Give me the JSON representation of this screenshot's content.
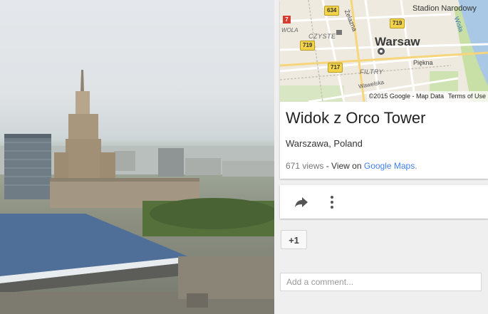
{
  "photo": {
    "alt_subject": "Warsaw skyline viewed from Orco Tower"
  },
  "map": {
    "city": "Warsaw",
    "stadium": "Stadion Narodowy",
    "street_piekna": "Piękna",
    "district_filtry": "FILTRY",
    "district_czyste": "CZYSTE",
    "district_wola": "WOLA",
    "street_wawelska": "Wawelska",
    "street_zelazna": "Żelazna",
    "river": "Wisła",
    "route_634": "634",
    "route_719_a": "719",
    "route_719_b": "719",
    "route_717": "717",
    "badge_7": "7",
    "copyright": "©2015 Google - Map Data",
    "terms": "Terms of Use"
  },
  "info": {
    "title": "Widok z Orco Tower",
    "location": "Warszawa, Poland",
    "views": "671 views",
    "separator": " - ",
    "view_on": "View on ",
    "maps_link": "Google Maps",
    "period": "."
  },
  "actions": {
    "share_icon": "share-arrow-icon",
    "more_icon": "vertical-dots-icon",
    "plus_one": "+1"
  },
  "comment": {
    "placeholder": "Add a comment..."
  },
  "colors": {
    "link": "#427fed",
    "route_shield": "#f3d34a",
    "card_bg": "#ffffff",
    "panel_bg": "#efefef"
  }
}
